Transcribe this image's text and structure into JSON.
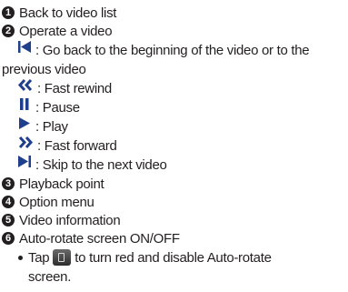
{
  "items": [
    {
      "number": "1",
      "text": "Back to video list"
    },
    {
      "number": "2",
      "text": "Operate a video"
    },
    {
      "number": "3",
      "text": "Playback point"
    },
    {
      "number": "4",
      "text": "Option menu"
    },
    {
      "number": "5",
      "text": "Video information"
    },
    {
      "number": "6",
      "text": "Auto-rotate screen ON/OFF"
    }
  ],
  "operate": {
    "prev_line1": ": Go back to the beginning of the video or to the",
    "prev_line2": "previous video",
    "rewind": ": Fast rewind",
    "pause": ": Pause",
    "play": ": Play",
    "forward": ": Fast forward",
    "next": ": Skip to the next video"
  },
  "rotate_note": {
    "before": "Tap",
    "after": "to turn red and disable Auto-rotate",
    "line2": "screen."
  },
  "colors": {
    "text": "#231f20",
    "icon": "#1f3e8c"
  },
  "icons": {
    "previous": "skip-previous-icon",
    "rewind": "fast-rewind-icon",
    "pause": "pause-icon",
    "play": "play-icon",
    "forward": "fast-forward-icon",
    "next": "skip-next-icon",
    "rotate": "auto-rotate-icon"
  }
}
